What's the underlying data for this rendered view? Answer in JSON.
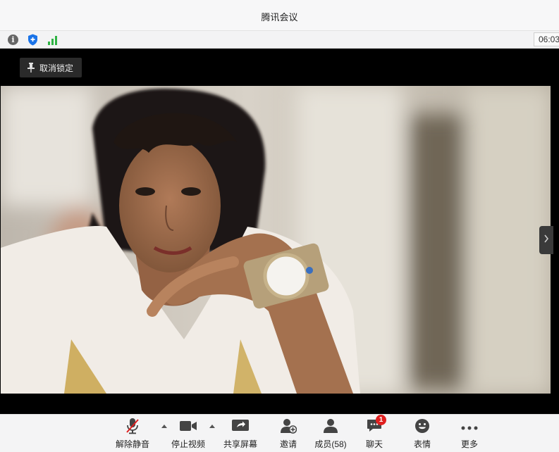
{
  "window": {
    "title": "腾讯会议"
  },
  "infobar": {
    "icons": [
      "info-icon",
      "shield-icon",
      "signal-icon"
    ],
    "timer": "06:03"
  },
  "video": {
    "unlock_label": "取消锁定",
    "pin_icon": "pin-icon",
    "side_toggle_icon": "chevron-right-icon"
  },
  "toolbar": {
    "unmute": {
      "label": "解除静音",
      "icon": "microphone-muted-icon"
    },
    "stop_video": {
      "label": "停止视频",
      "icon": "video-camera-icon"
    },
    "share_screen": {
      "label": "共享屏幕",
      "icon": "share-screen-icon"
    },
    "invite": {
      "label": "邀请",
      "icon": "add-user-icon"
    },
    "members": {
      "label": "成员(58)",
      "icon": "members-icon"
    },
    "chat": {
      "label": "聊天",
      "icon": "chat-icon",
      "badge": "1"
    },
    "reactions": {
      "label": "表情",
      "icon": "emoji-icon"
    },
    "more": {
      "label": "更多",
      "icon": "more-dots-icon"
    }
  },
  "colors": {
    "accent": "#1a73e8",
    "signal": "#2fb344",
    "badge": "#e02020",
    "muted": "#e02020"
  }
}
